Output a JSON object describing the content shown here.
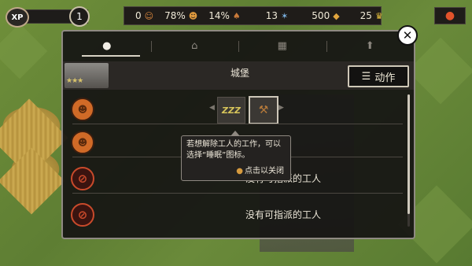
{
  "topbar": {
    "xp_label": "XP",
    "level": "1",
    "resources": [
      {
        "value": "0",
        "icon": "worker-icon",
        "glyph": "☺"
      },
      {
        "value": "78%",
        "icon": "happiness-icon",
        "glyph": "☻"
      },
      {
        "value": "14%",
        "icon": "food-icon",
        "glyph": "♠"
      },
      {
        "value": "13",
        "icon": "research-icon",
        "glyph": "✶"
      },
      {
        "value": "500",
        "icon": "gold-icon",
        "glyph": "◆"
      },
      {
        "value": "25",
        "icon": "crown-icon",
        "glyph": "♛"
      }
    ],
    "menu_icon": "●"
  },
  "panel": {
    "tabs": [
      {
        "name": "tab-workers",
        "glyph": "●",
        "active": true
      },
      {
        "name": "tab-house",
        "glyph": "⌂",
        "active": false
      },
      {
        "name": "tab-storage",
        "glyph": "▦",
        "active": false
      },
      {
        "name": "tab-upgrade",
        "glyph": "⬆",
        "active": false
      }
    ],
    "close_glyph": "✕",
    "building_title": "城堡",
    "stars": "★★★",
    "action_label": "动作",
    "action_icon": "☰",
    "rows": [
      {
        "type": "worker",
        "text": ""
      },
      {
        "type": "worker",
        "text": ""
      },
      {
        "type": "empty",
        "text": "没有可指派的工人"
      },
      {
        "type": "empty",
        "text": "没有可指派的工人"
      }
    ],
    "sleep_label": "ZZZ",
    "work_glyph": "⚒"
  },
  "tooltip": {
    "text": "若想解除工人的工作，可以选择“睡眠”图标。",
    "close_text": "点击以关闭"
  }
}
